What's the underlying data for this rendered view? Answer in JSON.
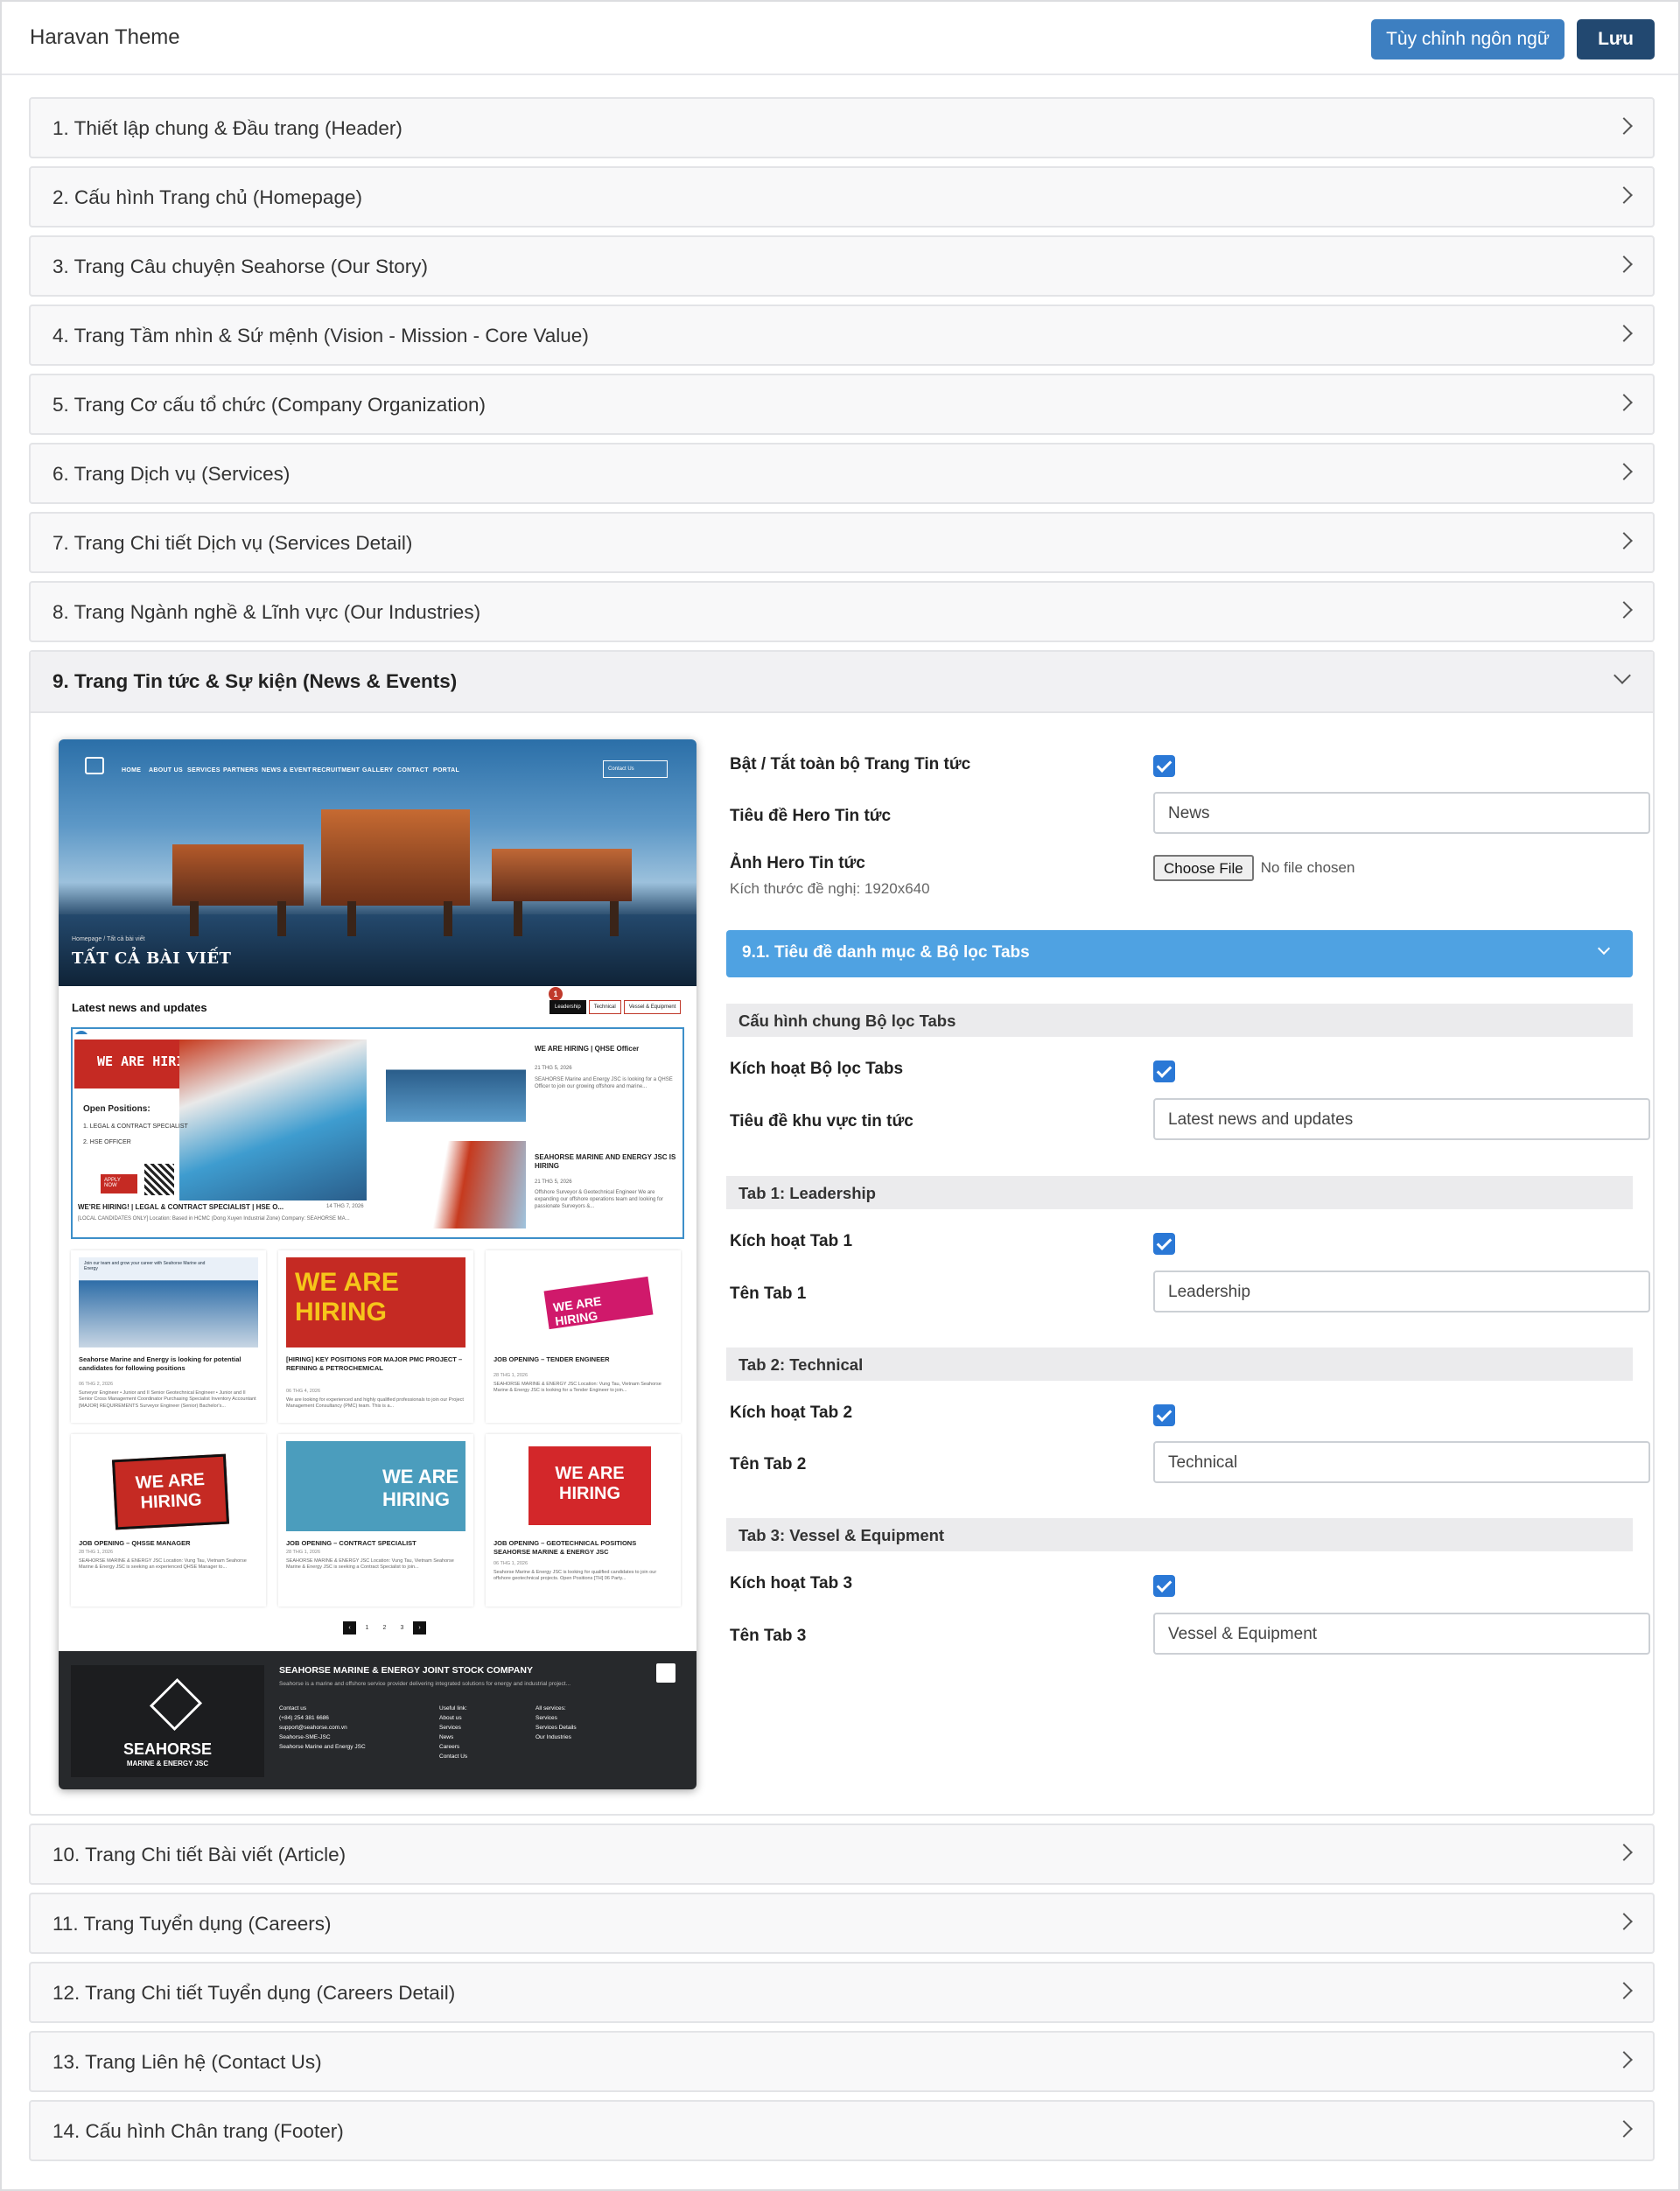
{
  "header": {
    "title": "Haravan Theme",
    "lang_button": "Tùy chỉnh ngôn ngữ",
    "save_button": "Lưu"
  },
  "sections_before": [
    "1. Thiết lập chung & Đầu trang (Header)",
    "2. Cấu hình Trang chủ (Homepage)",
    "3. Trang Câu chuyện Seahorse (Our Story)",
    "4. Trang Tầm nhìn & Sứ mệnh (Vision - Mission - Core Value)",
    "5. Trang Cơ cấu tổ chức (Company Organization)",
    "6. Trang Dịch vụ (Services)",
    "7. Trang Chi tiết Dịch vụ (Services Detail)",
    "8. Trang Ngành nghề & Lĩnh vực (Our Industries)"
  ],
  "open_section": {
    "label": "9. Trang Tin tức & Sự kiện (News & Events)",
    "fields": {
      "enable_label": "Bật / Tắt toàn bộ Trang Tin tức",
      "enable_checked": true,
      "hero_title_label": "Tiêu đề Hero Tin tức",
      "hero_title_value": "News",
      "hero_image_label": "Ảnh Hero Tin tức",
      "hero_image_hint": "Kích thước đề nghị: 1920x640",
      "file_button": "Choose File",
      "file_status": "No file chosen"
    },
    "subsection": {
      "label": "9.1. Tiêu đề danh mục & Bộ lọc Tabs",
      "general_group": "Cấu hình chung Bộ lọc Tabs",
      "enable_filter_label": "Kích hoạt Bộ lọc Tabs",
      "news_area_title_label": "Tiêu đề khu vực tin tức",
      "news_area_title_value": "Latest news and updates",
      "tab1_group": "Tab 1: Leadership",
      "tab1_enable_label": "Kích hoạt Tab 1",
      "tab1_name_label": "Tên Tab 1",
      "tab1_name_value": "Leadership",
      "tab2_group": "Tab 2: Technical",
      "tab2_enable_label": "Kích hoạt Tab 2",
      "tab2_name_label": "Tên Tab 2",
      "tab2_name_value": "Technical",
      "tab3_group": "Tab 3: Vessel & Equipment",
      "tab3_enable_label": "Kích hoạt Tab 3",
      "tab3_name_label": "Tên Tab 3",
      "tab3_name_value": "Vessel & Equipment"
    },
    "preview": {
      "nav": [
        "HOME",
        "ABOUT US",
        "SERVICES",
        "PARTNERS",
        "NEWS & EVENT",
        "RECRUITMENT",
        "GALLERY",
        "CONTACT",
        "PORTAL"
      ],
      "contact_btn": "Contact Us",
      "breadcrumb": "Homepage / Tất cả bài viết",
      "hero_title": "TẤT CẢ BÀI VIẾT",
      "section_title": "Latest news and updates",
      "tabs": [
        "Leadership",
        "Technical",
        "Vessel & Equipment"
      ],
      "badge1": "1",
      "badge2": "2",
      "featured": {
        "banner": "WE ARE HIRING",
        "positions_title": "Open Positions:",
        "position1": "1.  LEGAL & CONTRACT SPECIALIST",
        "position2": "2.  HSE OFFICER",
        "apply": "APPLY NOW",
        "main_title": "WE'RE HIRING! | LEGAL & CONTRACT SPECIALIST | HSE O...",
        "main_date": "14 THG 7, 2026",
        "main_text": "[LOCAL CANDIDATES ONLY] Location: Based in HCMC (Dong Xuyen Industrial Zone) Company: SEAHORSE MA...",
        "side1_title": "WE ARE HIRING | QHSE Officer",
        "side1_date": "21 THG 5, 2026",
        "side1_text": "SEAHORSE Marine and Energy JSC is looking for a QHSE Officer to join our growing offshore and marine...",
        "side2_title": "SEAHORSE MARINE AND ENERGY JSC IS HIRING",
        "side2_date": "21 THG 5, 2026",
        "side2_text": "Offshore Surveyor & Geotechnical Engineer We are expanding our offshore operations team and looking for passionate Surveyors &..."
      },
      "cards": [
        {
          "img": "Join our team and grow your career with Seahorse Marine and Energy",
          "title": "Seahorse Marine and Energy is looking for potential candidates for following positions",
          "date": "06 THG 2, 2026",
          "text": "Surveyor Engineer • Junior and II Senior Geotechnical Engineer • Junior and II Senior Cross Management Coordinator Purchasing Specialist Inventory Accountant [MAJOR] REQUIREMENTS Surveyor Engineer (Senior) Bachelor's..."
        },
        {
          "img": "WE ARE HIRING",
          "title": "[HIRING] KEY POSITIONS FOR MAJOR PMC PROJECT – REFINING & PETROCHEMICAL",
          "date": "06 THG 4, 2026",
          "text": "We are looking for experienced and highly qualified professionals to join our Project Management Consultancy (PMC) team. This is a..."
        },
        {
          "img": "WE ARE HIRING",
          "title": "JOB OPENING – TENDER ENGINEER",
          "date": "28 THG 1, 2026",
          "text": "SEAHORSE MARINE & ENERGY JSC Location: Vung Tau, Vietnam Seahorse Marine & Energy JSC is looking for a Tender Engineer to join..."
        },
        {
          "img": "WE ARE HIRING",
          "title": "JOB OPENING – QHSSE MANAGER",
          "date": "28 THG 1, 2026",
          "text": "SEAHORSE MARINE & ENERGY JSC Location: Vung Tau, Vietnam Seahorse Marine & Energy JSC is seeking an experienced QHSE Manager to..."
        },
        {
          "img": "WE ARE HIRING",
          "title": "JOB OPENING – CONTRACT SPECIALIST",
          "date": "28 THG 1, 2026",
          "text": "SEAHORSE MARINE & ENERGY JSC Location: Vung Tau, Vietnam Seahorse Marine & Energy JSC is seeking a Contract Specialist to join..."
        },
        {
          "img": "WE ARE HIRING",
          "title": "JOB OPENING – GEOTECHNICAL POSITIONS SEAHORSE MARINE & ENERGY JSC",
          "date": "06 THG 1, 2026",
          "text": "Seahorse Marine & Energy JSC is looking for qualified candidates to join our offshore geotechnical projects. Open Positions [TH] 06 Party..."
        }
      ],
      "pager": [
        "1",
        "2",
        "3"
      ],
      "footer": {
        "company": "SEAHORSE MARINE & ENERGY JOINT STOCK COMPANY",
        "tagline": "Seahorse is a marine and offshore service provider delivering integrated solutions for energy and industrial project...",
        "logo1": "SEAHORSE",
        "logo2": "MARINE & ENERGY JSC",
        "contact_h": "Contact us",
        "phone": "(+84) 254 381 6686",
        "email": "support@seahorse.com.vn",
        "c3": "Seahorse-SME-JSC",
        "c4": "Seahorse Marine and Energy JSC",
        "links_h": "Useful link:",
        "links": [
          "About us",
          "Services",
          "News",
          "Careers",
          "Contact Us"
        ],
        "svc_h": "All services:",
        "svcs": [
          "Services",
          "Services Details",
          "Our Industries"
        ]
      }
    }
  },
  "sections_after": [
    "10. Trang Chi tiết Bài viết (Article)",
    "11. Trang Tuyển dụng (Careers)",
    "12. Trang Chi tiết Tuyển dụng (Careers Detail)",
    "13. Trang Liên hệ (Contact Us)",
    "14. Cấu hình Chân trang (Footer)"
  ],
  "colors": {
    "primary": "#3d7fc1",
    "dark": "#224870",
    "sub_accordion": "#4fa2e2",
    "checkbox": "#2a78d6"
  }
}
